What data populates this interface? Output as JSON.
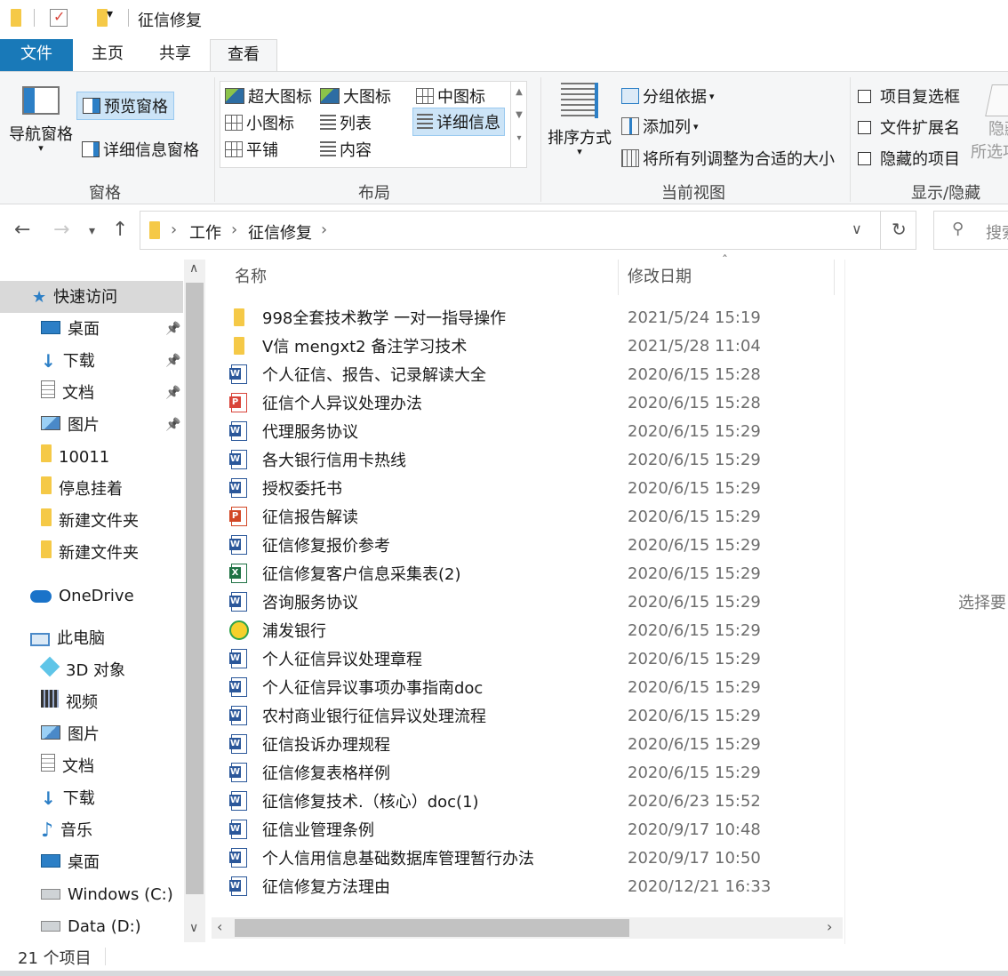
{
  "window": {
    "title": "征信修复"
  },
  "ribbon_tabs": [
    "文件",
    "主页",
    "共享",
    "查看"
  ],
  "ribbon": {
    "panes": {
      "nav_pane": "导航窗格",
      "preview_pane": "预览窗格",
      "details_pane": "详细信息窗格",
      "group": "窗格"
    },
    "layout": {
      "options": [
        "超大图标",
        "大图标",
        "中图标",
        "小图标",
        "列表",
        "详细信息",
        "平铺",
        "内容"
      ],
      "selected": "详细信息",
      "group": "布局"
    },
    "current_view": {
      "sort_by": "排序方式",
      "group_by": "分组依据",
      "add_columns": "添加列",
      "size_all": "将所有列调整为合适的大小",
      "group": "当前视图"
    },
    "show_hide": {
      "item_checkboxes": "项目复选框",
      "file_extensions": "文件扩展名",
      "hidden_items": "隐藏的项目",
      "hide_selected_1": "隐藏",
      "hide_selected_2": "所选项",
      "group": "显示/隐藏"
    }
  },
  "address": {
    "path": [
      "工作",
      "征信修复"
    ],
    "search_placeholder": "搜索"
  },
  "nav": {
    "quick_access": "快速访问",
    "items": [
      {
        "label": "桌面",
        "icon": "desktop-icon",
        "pinned": true
      },
      {
        "label": "下载",
        "icon": "download-icon",
        "pinned": true
      },
      {
        "label": "文档",
        "icon": "document-icon",
        "pinned": true
      },
      {
        "label": "图片",
        "icon": "picture-icon",
        "pinned": true
      },
      {
        "label": "10011",
        "icon": "folder-icon",
        "pinned": false
      },
      {
        "label": "停息挂着",
        "icon": "folder-icon",
        "pinned": false
      },
      {
        "label": "新建文件夹",
        "icon": "folder-icon",
        "pinned": false
      },
      {
        "label": "新建文件夹",
        "icon": "folder-icon",
        "pinned": false
      }
    ],
    "onedrive": "OneDrive",
    "this_pc": "此电脑",
    "pc_items": [
      {
        "label": "3D 对象",
        "icon": "3d-objects-icon"
      },
      {
        "label": "视频",
        "icon": "video-icon"
      },
      {
        "label": "图片",
        "icon": "picture-icon"
      },
      {
        "label": "文档",
        "icon": "document-icon"
      },
      {
        "label": "下载",
        "icon": "download-icon"
      },
      {
        "label": "音乐",
        "icon": "music-icon"
      },
      {
        "label": "桌面",
        "icon": "desktop-icon"
      },
      {
        "label": "Windows (C:)",
        "icon": "drive-icon"
      },
      {
        "label": "Data (D:)",
        "icon": "drive-icon"
      }
    ]
  },
  "columns": {
    "name": "名称",
    "modified": "修改日期"
  },
  "files": [
    {
      "name": "998全套技术教学  一对一指导操作",
      "date": "2021/5/24 15:19",
      "type": "folder"
    },
    {
      "name": "V信  mengxt2  备注学习技术",
      "date": "2021/5/28 11:04",
      "type": "folder"
    },
    {
      "name": "个人征信、报告、记录解读大全",
      "date": "2020/6/15 15:28",
      "type": "word"
    },
    {
      "name": "征信个人异议处理办法",
      "date": "2020/6/15 15:28",
      "type": "pdf"
    },
    {
      "name": "代理服务协议",
      "date": "2020/6/15 15:29",
      "type": "word"
    },
    {
      "name": "各大银行信用卡热线",
      "date": "2020/6/15 15:29",
      "type": "word"
    },
    {
      "name": "授权委托书",
      "date": "2020/6/15 15:29",
      "type": "word"
    },
    {
      "name": "征信报告解读",
      "date": "2020/6/15 15:29",
      "type": "ppt"
    },
    {
      "name": "征信修复报价参考",
      "date": "2020/6/15 15:29",
      "type": "word"
    },
    {
      "name": "征信修复客户信息采集表(2)",
      "date": "2020/6/15 15:29",
      "type": "excel"
    },
    {
      "name": "咨询服务协议",
      "date": "2020/6/15 15:29",
      "type": "word"
    },
    {
      "name": "浦发银行",
      "date": "2020/6/15 15:29",
      "type": "app"
    },
    {
      "name": "个人征信异议处理章程",
      "date": "2020/6/15 15:29",
      "type": "word"
    },
    {
      "name": "个人征信异议事项办事指南doc",
      "date": "2020/6/15 15:29",
      "type": "word"
    },
    {
      "name": "农村商业银行征信异议处理流程",
      "date": "2020/6/15 15:29",
      "type": "word"
    },
    {
      "name": "征信投诉办理规程",
      "date": "2020/6/15 15:29",
      "type": "word"
    },
    {
      "name": "征信修复表格样例",
      "date": "2020/6/15 15:29",
      "type": "word"
    },
    {
      "name": "征信修复技术.（核心）doc(1)",
      "date": "2020/6/23 15:52",
      "type": "word"
    },
    {
      "name": "征信业管理条例",
      "date": "2020/9/17 10:48",
      "type": "word"
    },
    {
      "name": "个人信用信息基础数据库管理暂行办法",
      "date": "2020/9/17 10:50",
      "type": "word"
    },
    {
      "name": "征信修复方法理由",
      "date": "2020/12/21 16:33",
      "type": "word"
    }
  ],
  "details_pane_text": "选择要",
  "status": {
    "item_count": "21 个项目"
  },
  "colors": {
    "file_tab": "#1979b8",
    "selection": "#cce4f7",
    "folder": "#f2c55c",
    "word": "#2b579a"
  }
}
